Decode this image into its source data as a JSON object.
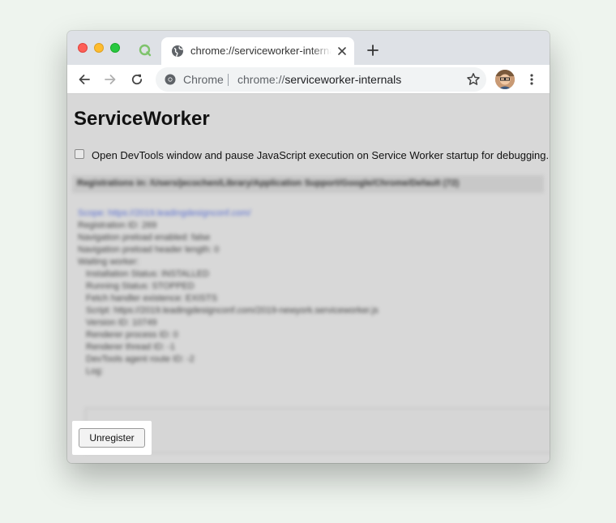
{
  "browser": {
    "tab_title": "chrome://serviceworker-internals",
    "omnibox": {
      "origin_label": "Chrome",
      "url_scheme": "chrome://",
      "url_rest": "serviceworker-internals"
    }
  },
  "page": {
    "title": "ServiceWorker",
    "debug_checkbox_label": "Open DevTools window and pause JavaScript execution on Service Worker startup for debugging.",
    "debug_checked": false,
    "registrations_header": "Registrations in: /Users/jecochen/Library/Application Support/Google/Chrome/Default (72)",
    "registration": {
      "scope_link": "Scope: https://2019.leadingdesignconf.com/",
      "details": [
        "Registration ID: 269",
        "Navigation preload enabled: false",
        "Navigation preload header length: 0",
        "Waiting worker:"
      ],
      "worker_details": [
        "Installation Status: INSTALLED",
        "Running Status: STOPPED",
        "Fetch handler existence: EXISTS",
        "Script: https://2019.leadingdesignconf.com/2019-newyork.serviceworker.js",
        "Version ID: 10749",
        "Renderer process ID: 0",
        "Renderer thread ID: -1",
        "DevTools agent route ID: -2",
        "Log:"
      ]
    },
    "unregister_label": "Unregister"
  },
  "colors": {
    "page_background": "#eef4ee",
    "tabstrip": "#dee1e6",
    "content_dimmed": "#d8d8d8",
    "link": "#5a6fd0"
  }
}
